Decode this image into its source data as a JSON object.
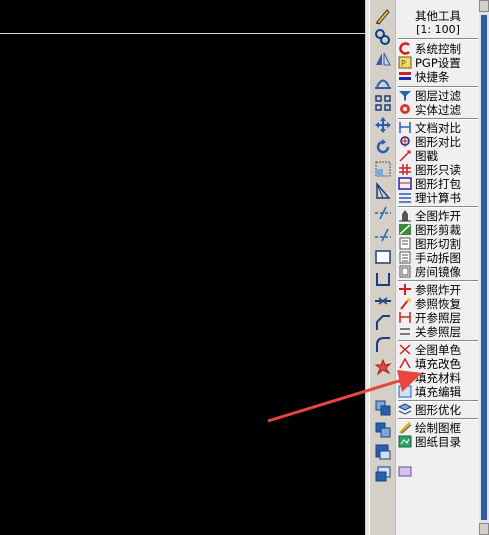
{
  "panel": {
    "title": "其他工具",
    "scale": "[1: 100]",
    "groups": [
      [
        "系统控制",
        "PGP设置",
        "快捷条"
      ],
      [
        "图层过滤",
        "实体过滤"
      ],
      [
        "文档对比",
        "图形对比",
        "图戳",
        "图形只读",
        "图形打包",
        "理计算书"
      ],
      [
        "全图炸开",
        "图形剪裁",
        "图形切割",
        "手动拆图",
        "房间镜像"
      ],
      [
        "参照炸开",
        "参照恢复",
        "开参照层",
        "关参照层"
      ],
      [
        "全图单色",
        "填充改色",
        "填充材料",
        "填充编辑"
      ],
      [
        "图形优化"
      ],
      [
        "绘制图框",
        "图纸目录"
      ]
    ]
  },
  "toolbar_icons": [
    "pencil-icon",
    "link-icon",
    "mirror-icon",
    "offset-icon",
    "array-icon",
    "move-icon",
    "rotate-icon",
    "scale-icon",
    "stretch-icon",
    "trim-icon",
    "extend-icon",
    "rectangle-icon",
    "bracket-icon",
    "join-icon",
    "chamfer-icon",
    "fillet-icon",
    "explode-icon",
    "layer-copy-icon",
    "layer-move-icon",
    "layer-front-icon",
    "layer-back-icon"
  ],
  "colors": {
    "canvas": "#000000",
    "panel": "#f0f0f0",
    "accent_arrow": "#e8453c",
    "scroll": "#2f5d9f"
  }
}
